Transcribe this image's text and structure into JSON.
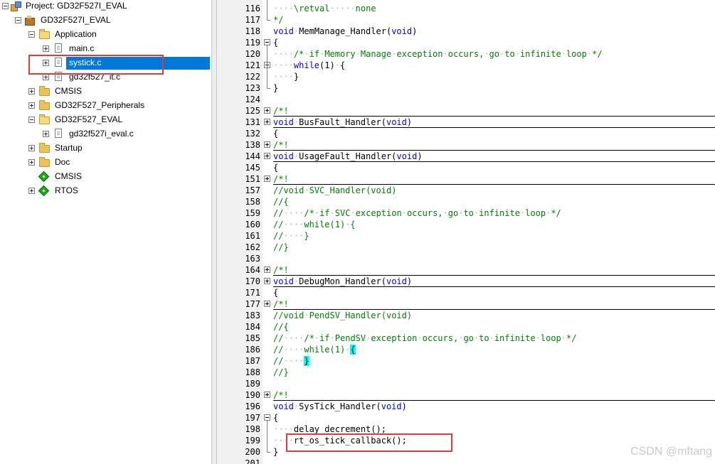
{
  "project_tree": {
    "items": [
      {
        "label": "Project: GD32F527I_EVAL"
      },
      {
        "label": "GD32F527I_EVAL"
      },
      {
        "label": "Application"
      },
      {
        "label": "main.c"
      },
      {
        "label": "systick.c"
      },
      {
        "label": "gd32f527_it.c"
      },
      {
        "label": "CMSIS"
      },
      {
        "label": "GD32F527_Peripherals"
      },
      {
        "label": "GD32F527_EVAL"
      },
      {
        "label": "gd32f527i_eval.c"
      },
      {
        "label": "Startup"
      },
      {
        "label": "Doc"
      },
      {
        "label": "CMSIS"
      },
      {
        "label": "RTOS"
      }
    ]
  },
  "editor": {
    "lines": [
      {
        "num": "116",
        "text": "\\retval·····none"
      },
      {
        "num": "117",
        "text": "*/"
      },
      {
        "num": "118",
        "text": "void·MemManage_Handler(void)"
      },
      {
        "num": "119",
        "text": "{"
      },
      {
        "num": "120",
        "text": "/*·if·Memory·Manage·exception·occurs,·go·to·infinite·loop·*/"
      },
      {
        "num": "121",
        "text": "while(1)·{"
      },
      {
        "num": "122",
        "text": "}"
      },
      {
        "num": "123",
        "text": "}"
      },
      {
        "num": "124",
        "text": ""
      },
      {
        "num": "125",
        "text": "/*!"
      },
      {
        "num": "131",
        "text": "void·BusFault_Handler(void)"
      },
      {
        "num": "132",
        "text": "{"
      },
      {
        "num": "138",
        "text": "/*!"
      },
      {
        "num": "144",
        "text": "void·UsageFault_Handler(void)"
      },
      {
        "num": "145",
        "text": "{"
      },
      {
        "num": "151",
        "text": "/*!"
      },
      {
        "num": "157",
        "text": "//void·SVC_Handler(void)"
      },
      {
        "num": "158",
        "text": "//{"
      },
      {
        "num": "159",
        "text": "//····/*·if·SVC·exception·occurs,·go·to·infinite·loop·*/"
      },
      {
        "num": "160",
        "text": "//····while(1)·{"
      },
      {
        "num": "161",
        "text": "//····}"
      },
      {
        "num": "162",
        "text": "//}"
      },
      {
        "num": "163",
        "text": ""
      },
      {
        "num": "164",
        "text": "/*!"
      },
      {
        "num": "170",
        "text": "void·DebugMon_Handler(void)"
      },
      {
        "num": "171",
        "text": "{"
      },
      {
        "num": "177",
        "text": "/*!"
      },
      {
        "num": "183",
        "text": "//void·PendSV_Handler(void)"
      },
      {
        "num": "184",
        "text": "//{"
      },
      {
        "num": "185",
        "text": "//····/*·if·PendSV·exception·occurs,·go·to·infinite·loop·*/"
      },
      {
        "num": "186",
        "text": "//····while(1)·{"
      },
      {
        "num": "187",
        "text": "//····}"
      },
      {
        "num": "188",
        "text": "//}"
      },
      {
        "num": "189",
        "text": ""
      },
      {
        "num": "190",
        "text": "/*!"
      },
      {
        "num": "196",
        "text": "void·SysTick_Handler(void)"
      },
      {
        "num": "197",
        "text": "{"
      },
      {
        "num": "198",
        "text": "delay_decrement();"
      },
      {
        "num": "199",
        "text": "rt_os_tick_callback();"
      },
      {
        "num": "200",
        "text": "}"
      },
      {
        "num": "201",
        "text": ""
      }
    ]
  },
  "watermark": "CSDN @mftang"
}
